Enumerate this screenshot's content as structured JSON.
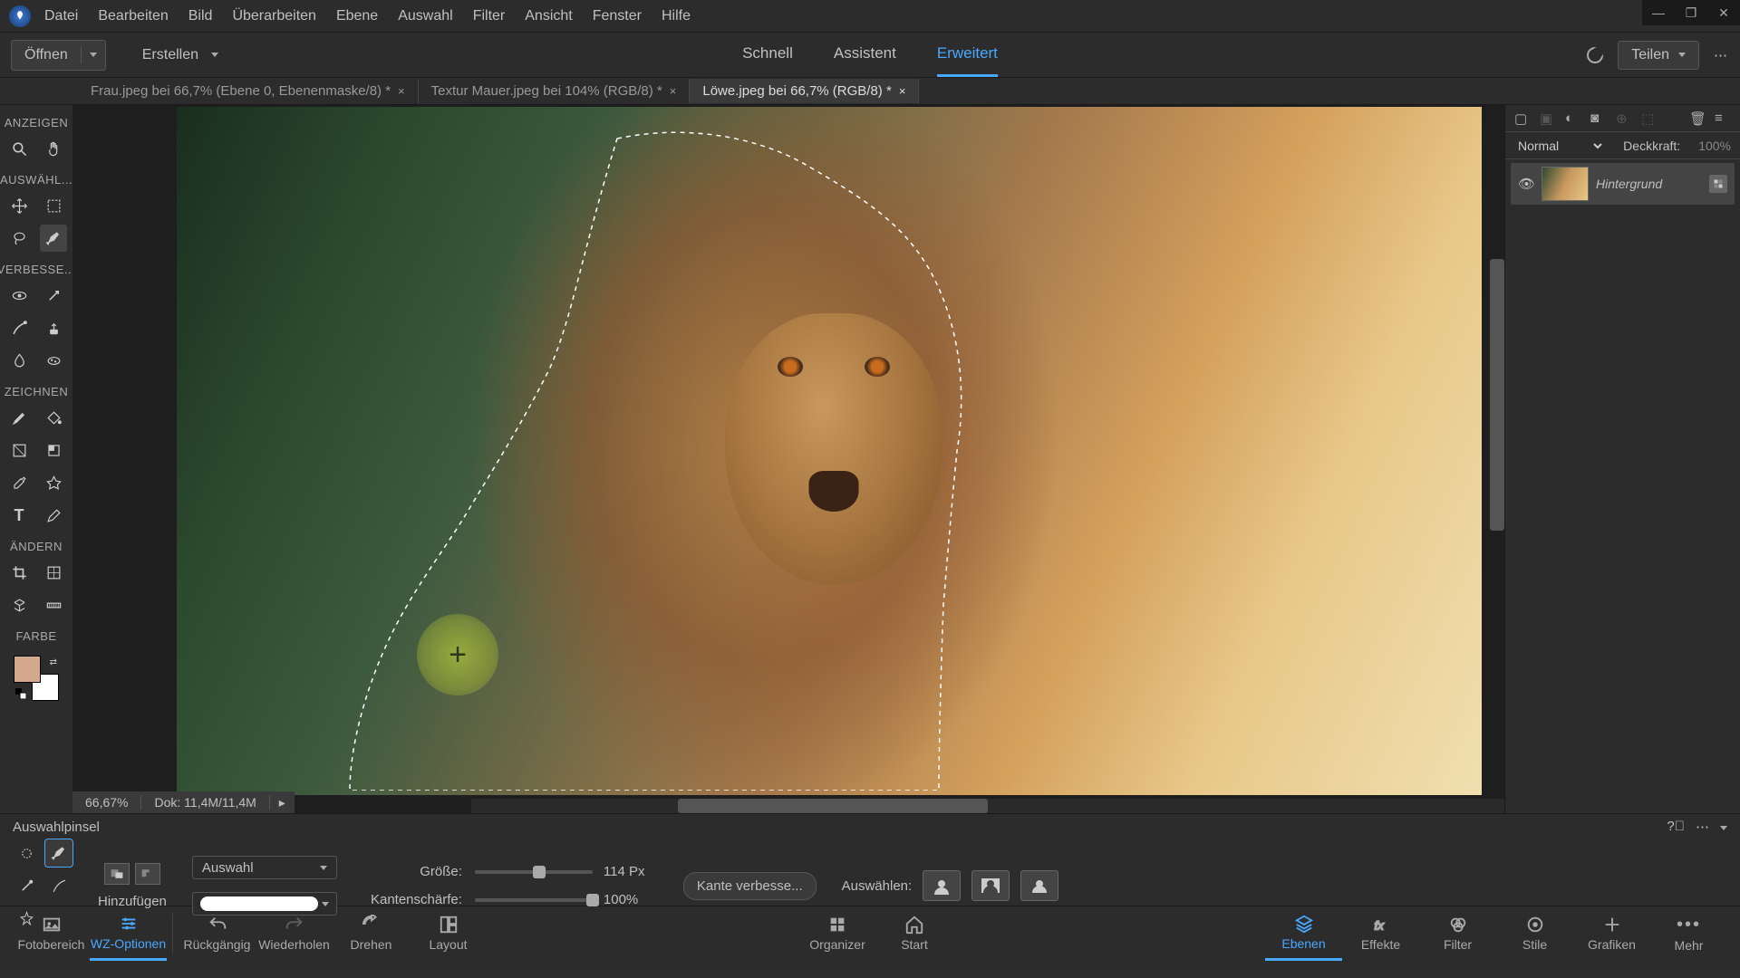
{
  "menu": [
    "Datei",
    "Bearbeiten",
    "Bild",
    "Überarbeiten",
    "Ebene",
    "Auswahl",
    "Filter",
    "Ansicht",
    "Fenster",
    "Hilfe"
  ],
  "toolbar": {
    "open": "Öffnen",
    "create": "Erstellen",
    "tabs": [
      "Schnell",
      "Assistent",
      "Erweitert"
    ],
    "active_tab": 2,
    "share": "Teilen"
  },
  "doc_tabs": [
    {
      "label": "Frau.jpeg bei 66,7% (Ebene 0, Ebenenmaske/8) *",
      "active": false
    },
    {
      "label": "Textur Mauer.jpeg bei 104% (RGB/8) *",
      "active": false
    },
    {
      "label": "Löwe.jpeg bei 66,7% (RGB/8) *",
      "active": true
    }
  ],
  "tool_groups": {
    "anzeigen": "ANZEIGEN",
    "auswahl": "AUSWÄHL...",
    "verbessern": "VERBESSE...",
    "zeichnen": "ZEICHNEN",
    "aendern": "ÄNDERN",
    "farbe": "FARBE"
  },
  "canvas": {
    "zoom": "66,67%",
    "dok": "Dok: 11,4M/11,4M"
  },
  "layers": {
    "blend": "Normal",
    "opacity_label": "Deckkraft:",
    "opacity_value": "100%",
    "layer1_name": "Hintergrund"
  },
  "options": {
    "title": "Auswahlpinsel",
    "hinzu": "Hinzufügen",
    "mode": "Auswahl",
    "groesse_label": "Größe:",
    "groesse_value": "114 Px",
    "kante_label": "Kantenschärfe:",
    "kante_value": "100%",
    "kante_button": "Kante verbesse...",
    "auswaehlen": "Auswählen:"
  },
  "bottom_left": [
    "Fotobereich",
    "WZ-Optionen",
    "Rückgängig",
    "Wiederholen",
    "Drehen",
    "Layout"
  ],
  "bottom_center": [
    "Organizer",
    "Start"
  ],
  "bottom_right": [
    "Ebenen",
    "Effekte",
    "Filter",
    "Stile",
    "Grafiken",
    "Mehr"
  ]
}
